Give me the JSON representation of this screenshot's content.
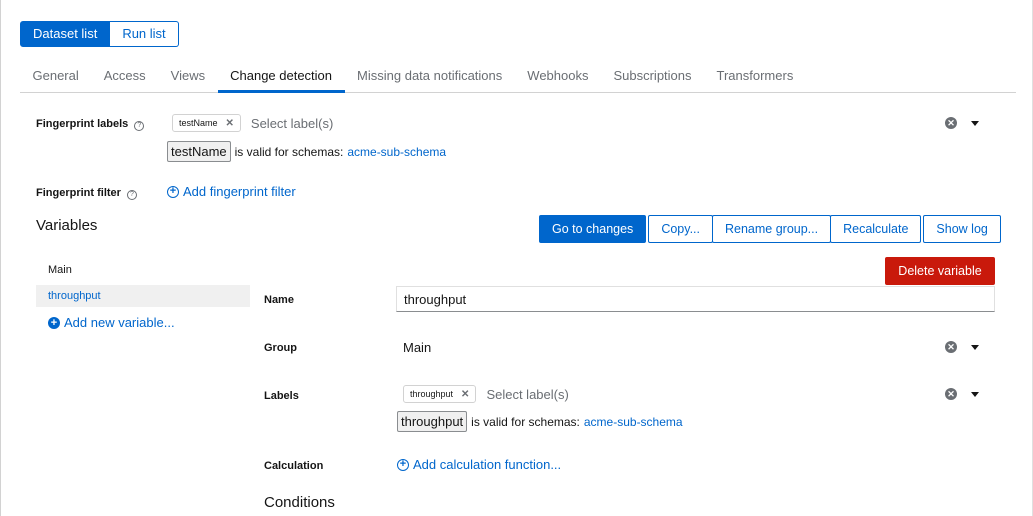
{
  "view_toggle": {
    "dataset_list": "Dataset list",
    "run_list": "Run list"
  },
  "tabs": [
    {
      "label": "General"
    },
    {
      "label": "Access"
    },
    {
      "label": "Views"
    },
    {
      "label": "Change detection",
      "active": true
    },
    {
      "label": "Missing data notifications"
    },
    {
      "label": "Webhooks"
    },
    {
      "label": "Subscriptions"
    },
    {
      "label": "Transformers"
    }
  ],
  "fingerprint_labels": {
    "label": "Fingerprint labels",
    "chip": "testName",
    "placeholder": "Select label(s)",
    "valid_label": "testName",
    "valid_text": "is valid for schemas:",
    "schema": "acme-sub-schema"
  },
  "fingerprint_filter": {
    "label": "Fingerprint filter",
    "add_link": "Add fingerprint filter"
  },
  "variables": {
    "title": "Variables",
    "actions": {
      "go_to_changes": "Go to changes",
      "copy": "Copy...",
      "rename_group": "Rename group...",
      "recalculate": "Recalculate",
      "show_log": "Show log"
    },
    "sidebar": {
      "group": "Main",
      "items": [
        {
          "label": "throughput"
        }
      ],
      "add_new": "Add new variable..."
    },
    "delete_button": "Delete variable",
    "form": {
      "name_label": "Name",
      "name_value": "throughput",
      "group_label": "Group",
      "group_value": "Main",
      "labels_label": "Labels",
      "labels_chip": "throughput",
      "labels_placeholder": "Select label(s)",
      "labels_valid_label": "throughput",
      "labels_valid_text": "is valid for schemas:",
      "labels_schema": "acme-sub-schema",
      "calculation_label": "Calculation",
      "calculation_link": "Add calculation function...",
      "conditions_title": "Conditions"
    }
  },
  "colors": {
    "primary": "#0066cc",
    "danger": "#c9190b",
    "text": "#151515",
    "muted": "#6a6e73"
  }
}
